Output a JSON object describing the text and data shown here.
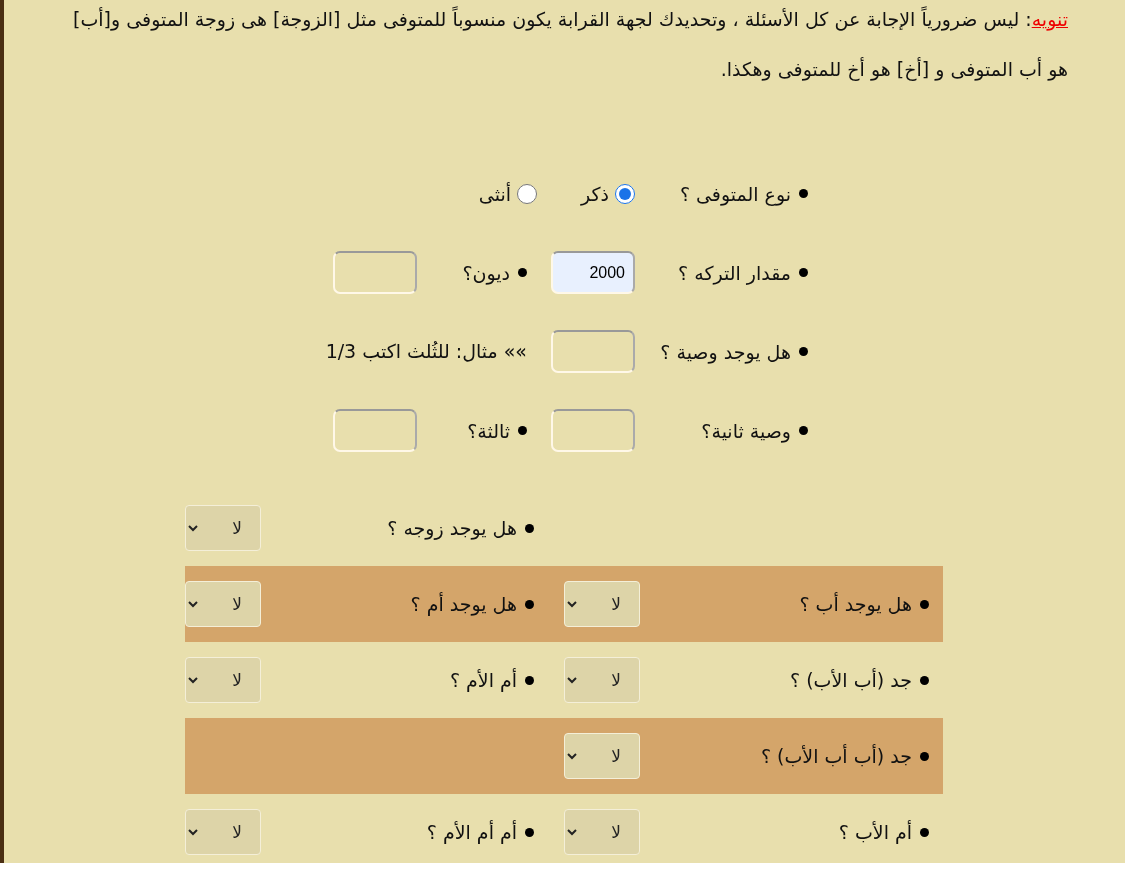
{
  "note": {
    "link": "تنويه",
    "text": ": ليس ضرورياً الإجابة عن كل الأسئلة ، وتحديدك لجهة القرابة يكون منسوباً للمتوفى مثل [الزوجة] هى زوجة المتوفى و[أب] هو أب المتوفى و [أخ] هو أخ للمتوفى وهكذا."
  },
  "form": {
    "rows": [
      {
        "kind": "radio",
        "label": "نوع المتوفى ؟",
        "options": [
          {
            "label": "ذكر",
            "selected": true
          },
          {
            "label": "أنثى",
            "selected": false
          }
        ]
      },
      {
        "kind": "inputs",
        "items": [
          {
            "label": "مقدار التركه ؟",
            "value": "2000"
          },
          {
            "label": "ديون؟"
          }
        ]
      },
      {
        "kind": "hint",
        "items": [
          {
            "label": "هل يوجد وصية ؟"
          }
        ],
        "hint": "»» مثال: للثُلث اكتب 1/3"
      },
      {
        "kind": "inputs",
        "items": [
          {
            "label": "وصية ثانية؟"
          },
          {
            "label": "ثالثة؟"
          }
        ]
      }
    ]
  },
  "relatives": {
    "rows": [
      {
        "highlighted": false,
        "cells": [
          "",
          {
            "label": "هل يوجد زوجه ؟",
            "value": "لا"
          }
        ]
      },
      {
        "highlighted": true,
        "cells": [
          {
            "label": "هل يوجد أب ؟",
            "value": "لا"
          },
          {
            "label": "هل يوجد أم ؟",
            "value": "لا"
          }
        ]
      },
      {
        "highlighted": false,
        "cells": [
          {
            "label": "جد (أب الأب) ؟",
            "value": "لا"
          },
          {
            "label": "أم الأم ؟",
            "value": "لا"
          }
        ]
      },
      {
        "highlighted": true,
        "cells": [
          {
            "label": "جد (أب أب الأب) ؟",
            "value": "لا"
          }
        ]
      },
      {
        "highlighted": false,
        "cells": [
          {
            "label": "أم الأب ؟",
            "value": "لا"
          },
          {
            "label": "أم أم الأم ؟",
            "value": "لا"
          }
        ]
      }
    ]
  }
}
